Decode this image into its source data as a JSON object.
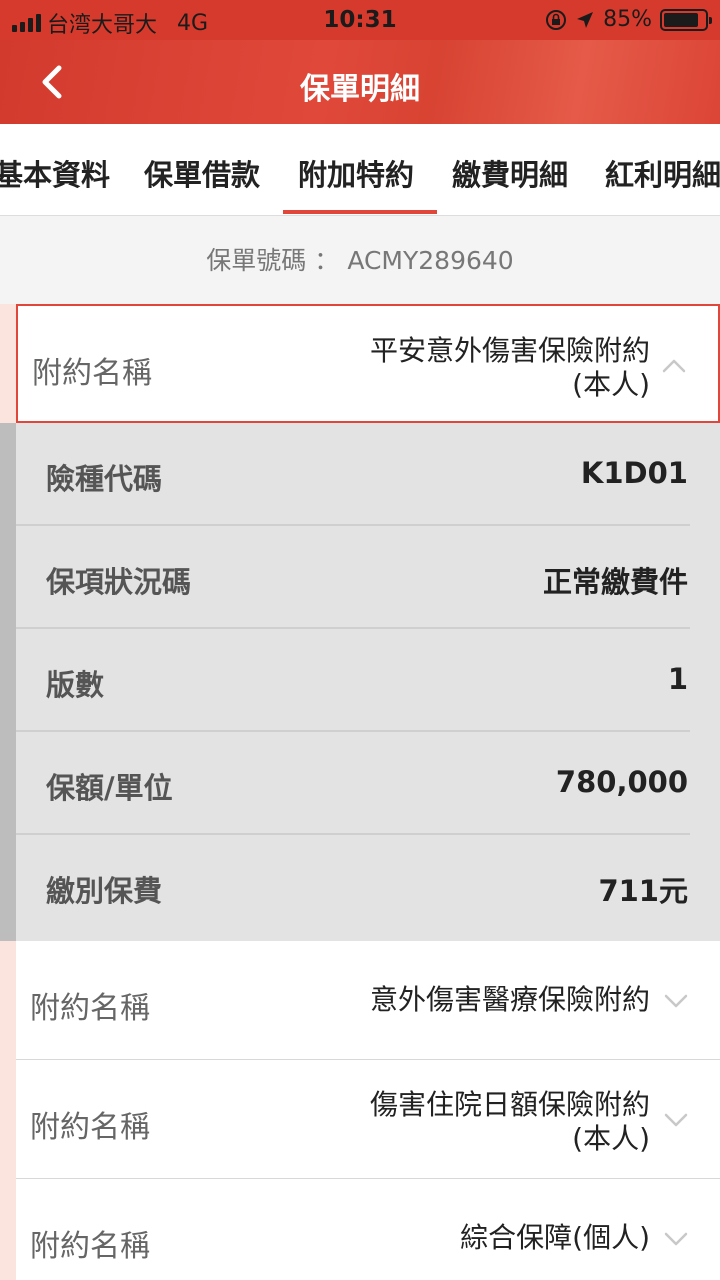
{
  "status_bar": {
    "carrier": "台湾大哥大",
    "network": "4G",
    "time": "10:31",
    "battery": "85%",
    "battery_level": 0.85
  },
  "header": {
    "title": "保單明細",
    "back_icon": "chevron-left-icon"
  },
  "tabs": [
    {
      "label": "基本資料",
      "active": false
    },
    {
      "label": "保單借款",
      "active": false
    },
    {
      "label": "附加特約",
      "active": true
    },
    {
      "label": "繳費明細",
      "active": false
    },
    {
      "label": "紅利明細",
      "active": false
    }
  ],
  "policy": {
    "label": "保單號碼",
    "separator": "：",
    "number": "ACMY289640"
  },
  "riders": [
    {
      "label": "附約名稱",
      "name_line1": "平安意外傷害保險附約",
      "name_line2": "(本人)",
      "expanded": true,
      "details": [
        {
          "label": "險種代碼",
          "value": "K1D01"
        },
        {
          "label": "保項狀況碼",
          "value": "正常繳費件"
        },
        {
          "label": "版數",
          "value": "1"
        },
        {
          "label": "保額/單位",
          "value": "780,000"
        },
        {
          "label": "繳別保費",
          "value": "711元"
        }
      ]
    },
    {
      "label": "附約名稱",
      "name_line1": "意外傷害醫療保險附約",
      "name_line2": "",
      "expanded": false
    },
    {
      "label": "附約名稱",
      "name_line1": "傷害住院日額保險附約",
      "name_line2": "(本人)",
      "expanded": false
    },
    {
      "label": "附約名稱",
      "name_line1": "綜合保障(個人)",
      "name_line2": "",
      "expanded": false
    }
  ],
  "colors": {
    "brand_red": "#d63a2c",
    "active_border": "#e0473a",
    "detail_bg": "#e3e3e3"
  }
}
